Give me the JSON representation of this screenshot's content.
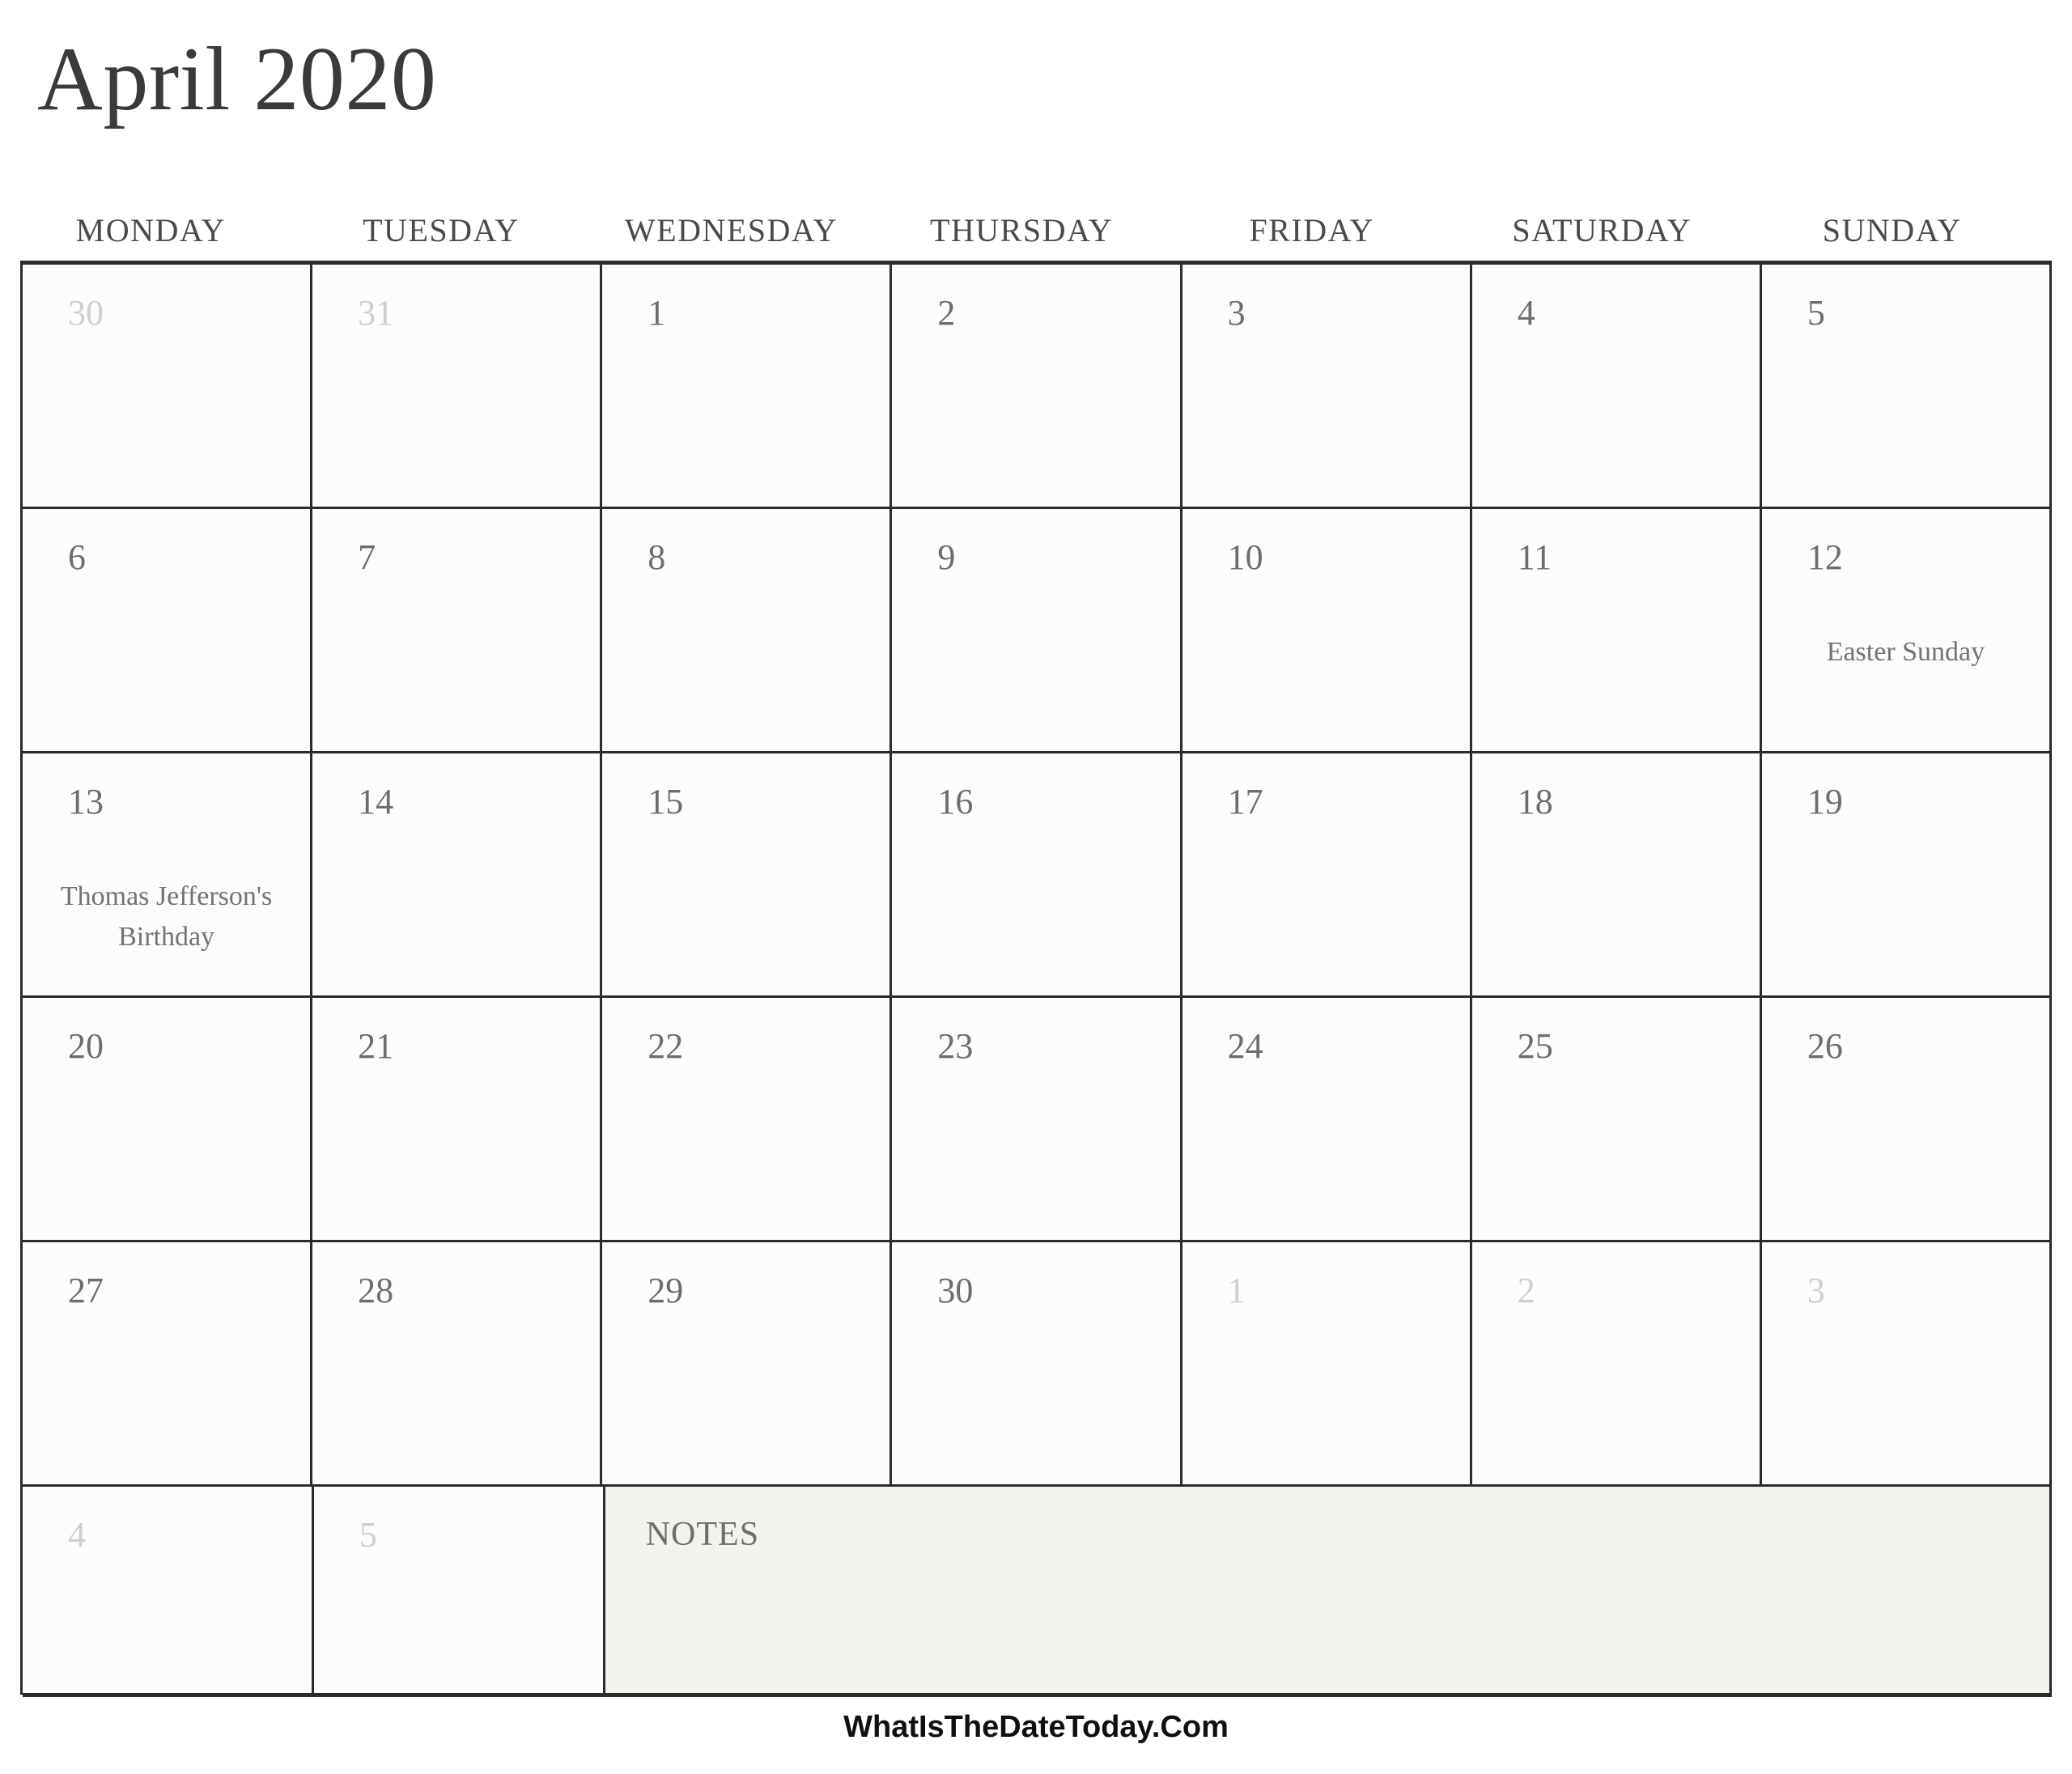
{
  "title": "April 2020",
  "month": "April",
  "year": "2020",
  "weekdays": [
    "MONDAY",
    "TUESDAY",
    "WEDNESDAY",
    "THURSDAY",
    "FRIDAY",
    "SATURDAY",
    "SUNDAY"
  ],
  "weeks": [
    {
      "days": [
        {
          "num": "30",
          "in_month": false,
          "event": ""
        },
        {
          "num": "31",
          "in_month": false,
          "event": ""
        },
        {
          "num": "1",
          "in_month": true,
          "event": ""
        },
        {
          "num": "2",
          "in_month": true,
          "event": ""
        },
        {
          "num": "3",
          "in_month": true,
          "event": ""
        },
        {
          "num": "4",
          "in_month": true,
          "event": ""
        },
        {
          "num": "5",
          "in_month": true,
          "event": ""
        }
      ]
    },
    {
      "days": [
        {
          "num": "6",
          "in_month": true,
          "event": ""
        },
        {
          "num": "7",
          "in_month": true,
          "event": ""
        },
        {
          "num": "8",
          "in_month": true,
          "event": ""
        },
        {
          "num": "9",
          "in_month": true,
          "event": ""
        },
        {
          "num": "10",
          "in_month": true,
          "event": ""
        },
        {
          "num": "11",
          "in_month": true,
          "event": ""
        },
        {
          "num": "12",
          "in_month": true,
          "event": "Easter Sunday"
        }
      ]
    },
    {
      "days": [
        {
          "num": "13",
          "in_month": true,
          "event": "Thomas Jefferson's Birthday"
        },
        {
          "num": "14",
          "in_month": true,
          "event": ""
        },
        {
          "num": "15",
          "in_month": true,
          "event": ""
        },
        {
          "num": "16",
          "in_month": true,
          "event": ""
        },
        {
          "num": "17",
          "in_month": true,
          "event": ""
        },
        {
          "num": "18",
          "in_month": true,
          "event": ""
        },
        {
          "num": "19",
          "in_month": true,
          "event": ""
        }
      ]
    },
    {
      "days": [
        {
          "num": "20",
          "in_month": true,
          "event": ""
        },
        {
          "num": "21",
          "in_month": true,
          "event": ""
        },
        {
          "num": "22",
          "in_month": true,
          "event": ""
        },
        {
          "num": "23",
          "in_month": true,
          "event": ""
        },
        {
          "num": "24",
          "in_month": true,
          "event": ""
        },
        {
          "num": "25",
          "in_month": true,
          "event": ""
        },
        {
          "num": "26",
          "in_month": true,
          "event": ""
        }
      ]
    },
    {
      "days": [
        {
          "num": "27",
          "in_month": true,
          "event": ""
        },
        {
          "num": "28",
          "in_month": true,
          "event": ""
        },
        {
          "num": "29",
          "in_month": true,
          "event": ""
        },
        {
          "num": "30",
          "in_month": true,
          "event": ""
        },
        {
          "num": "1",
          "in_month": false,
          "event": ""
        },
        {
          "num": "2",
          "in_month": false,
          "event": ""
        },
        {
          "num": "3",
          "in_month": false,
          "event": ""
        }
      ]
    }
  ],
  "last_row": {
    "days": [
      {
        "num": "4",
        "in_month": false,
        "event": ""
      },
      {
        "num": "5",
        "in_month": false,
        "event": ""
      }
    ],
    "notes_label": "NOTES"
  },
  "footer": {
    "text": "WhatIsTheDateToday.Com"
  },
  "colors": {
    "grid_line": "#2b2b2b",
    "title_text": "#3a3a3a",
    "in_month_number": "#6d6d6d",
    "out_month_number": "#cfcfcf",
    "event_text": "#737373",
    "notes_background": "#f2f3ec",
    "cell_background": "#fcfcfc",
    "page_background": "#ffffff",
    "footer_text": "#101010"
  }
}
